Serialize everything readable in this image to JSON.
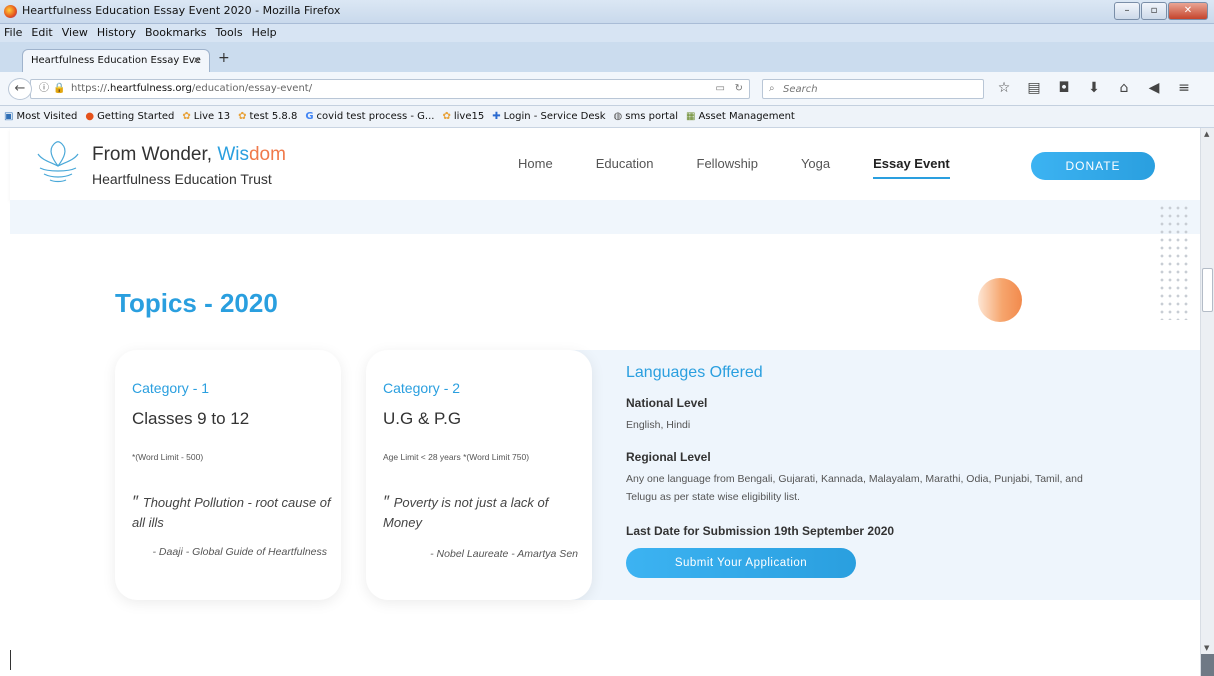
{
  "window": {
    "title": "Heartfulness Education Essay Event 2020 - Mozilla Firefox",
    "controls": [
      "–",
      "▫",
      "✕"
    ]
  },
  "menu": [
    "File",
    "Edit",
    "View",
    "History",
    "Bookmarks",
    "Tools",
    "Help"
  ],
  "tab": {
    "label": "Heartfulness Education Essay Eve",
    "close": "×",
    "new_tab": "+"
  },
  "url": {
    "prefix": "https://",
    "host": ".heartfulness.org",
    "path": "/education/essay-event/"
  },
  "search": {
    "placeholder": "Search"
  },
  "bookmarks": [
    "Most Visited",
    "Getting Started",
    "Live 13",
    "test 5.8.8",
    "covid test process - G...",
    "live15",
    "Login - Service Desk",
    "sms portal",
    "Asset Management"
  ],
  "site": {
    "brand_line1_a": "From Wonder, ",
    "brand_line1_b": "Wis",
    "brand_line1_c": "dom",
    "brand_line2": "Heartfulness Education Trust",
    "nav": [
      "Home",
      "Education",
      "Fellowship",
      "Yoga",
      "Essay Event"
    ],
    "donate": "DONATE"
  },
  "topics_title": "Topics - 2020",
  "cards": [
    {
      "category": "Category - 1",
      "level": "Classes 9 to 12",
      "limit": "*(Word Limit - 500)",
      "quote": "Thought Pollution - root cause of all ills",
      "author": "- Daaji - Global Guide of Heartfulness"
    },
    {
      "category": "Category - 2",
      "level": "U.G & P.G",
      "limit": "Age Limit < 28 years *(Word Limit 750)",
      "quote": "Poverty is not just a lack of Money",
      "author": "- Nobel Laureate - Amartya Sen"
    }
  ],
  "languages": {
    "heading": "Languages Offered",
    "national_title": "National Level",
    "national_text": "English, Hindi",
    "regional_title": "Regional Level",
    "regional_text": "Any one language from Bengali, Gujarati, Kannada, Malayalam, Marathi, Odia, Punjabi, Tamil, and Telugu as per state wise eligibility list.",
    "last_date": "Last Date for Submission 19th September 2020",
    "submit": "Submit Your Application"
  },
  "colors": {
    "accent": "#2a9fdf",
    "orange": "#f0794a",
    "panel": "#eef5fc"
  }
}
